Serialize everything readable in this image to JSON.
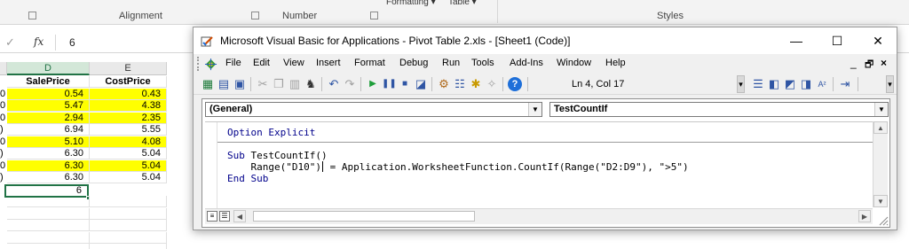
{
  "excel": {
    "ribbon": {
      "groups": [
        {
          "label": "Alignment"
        },
        {
          "label": "Number"
        },
        {
          "label": "Styles"
        }
      ],
      "style_buttons": [
        "Formatting ▾",
        "Table ▾"
      ]
    },
    "formula_bar": {
      "cancel_symbol": "✓",
      "fx_label": "fx",
      "value": "6"
    },
    "columns": [
      "D",
      "E"
    ],
    "headers": [
      "SalePrice",
      "CostPrice"
    ],
    "rows": [
      {
        "a": "0",
        "sale": "0.54",
        "cost": "0.43",
        "highlight": true
      },
      {
        "a": "0",
        "sale": "5.47",
        "cost": "4.38",
        "highlight": true
      },
      {
        "a": "0",
        "sale": "2.94",
        "cost": "2.35",
        "highlight": true
      },
      {
        "a": ")",
        "sale": "6.94",
        "cost": "5.55",
        "highlight": false
      },
      {
        "a": "0",
        "sale": "5.10",
        "cost": "4.08",
        "highlight": true
      },
      {
        "a": ")",
        "sale": "6.30",
        "cost": "5.04",
        "highlight": false
      },
      {
        "a": "0",
        "sale": "6.30",
        "cost": "5.04",
        "highlight": true
      },
      {
        "a": ")",
        "sale": "6.30",
        "cost": "5.04",
        "highlight": false
      }
    ],
    "result_cell": "6",
    "colors": {
      "highlight": "#ffff00",
      "selection": "#217346"
    }
  },
  "vbe": {
    "title": "Microsoft Visual Basic for Applications - Pivot Table 2.xls - [Sheet1 (Code)]",
    "window_buttons": {
      "minimize": "—",
      "maximize": "☐",
      "close": "✕"
    },
    "menu": [
      "File",
      "Edit",
      "View",
      "Insert",
      "Format",
      "Debug",
      "Run",
      "Tools",
      "Add-Ins",
      "Window",
      "Help"
    ],
    "menu_right": {
      "min": "_",
      "restore": "🗗",
      "close": "×"
    },
    "toolbar": {
      "position": "Ln 4, Col 17",
      "icons": [
        "view-excel-icon",
        "insert-module-icon",
        "save-icon",
        "cut-icon",
        "copy-icon",
        "paste-icon",
        "find-icon",
        "undo-icon",
        "redo-icon",
        "run-icon",
        "break-icon",
        "reset-icon",
        "design-mode-icon",
        "project-explorer-icon",
        "properties-icon",
        "object-browser-icon",
        "toolbox-icon",
        "help-icon"
      ],
      "help_symbol": "?"
    },
    "code": {
      "object_combo": "(General)",
      "procedure_combo": "TestCountIf",
      "lines": [
        {
          "keyword": "Option Explicit",
          "rest": ""
        },
        {
          "keyword": "Sub",
          "rest": " TestCountIf()"
        },
        {
          "keyword": "",
          "pre": "    Range(\"D10\")",
          "post": " = Application.WorksheetFunction.CountIf(Range(\"D2:D9\"), \">5\")"
        },
        {
          "keyword": "End Sub",
          "rest": ""
        }
      ]
    }
  }
}
